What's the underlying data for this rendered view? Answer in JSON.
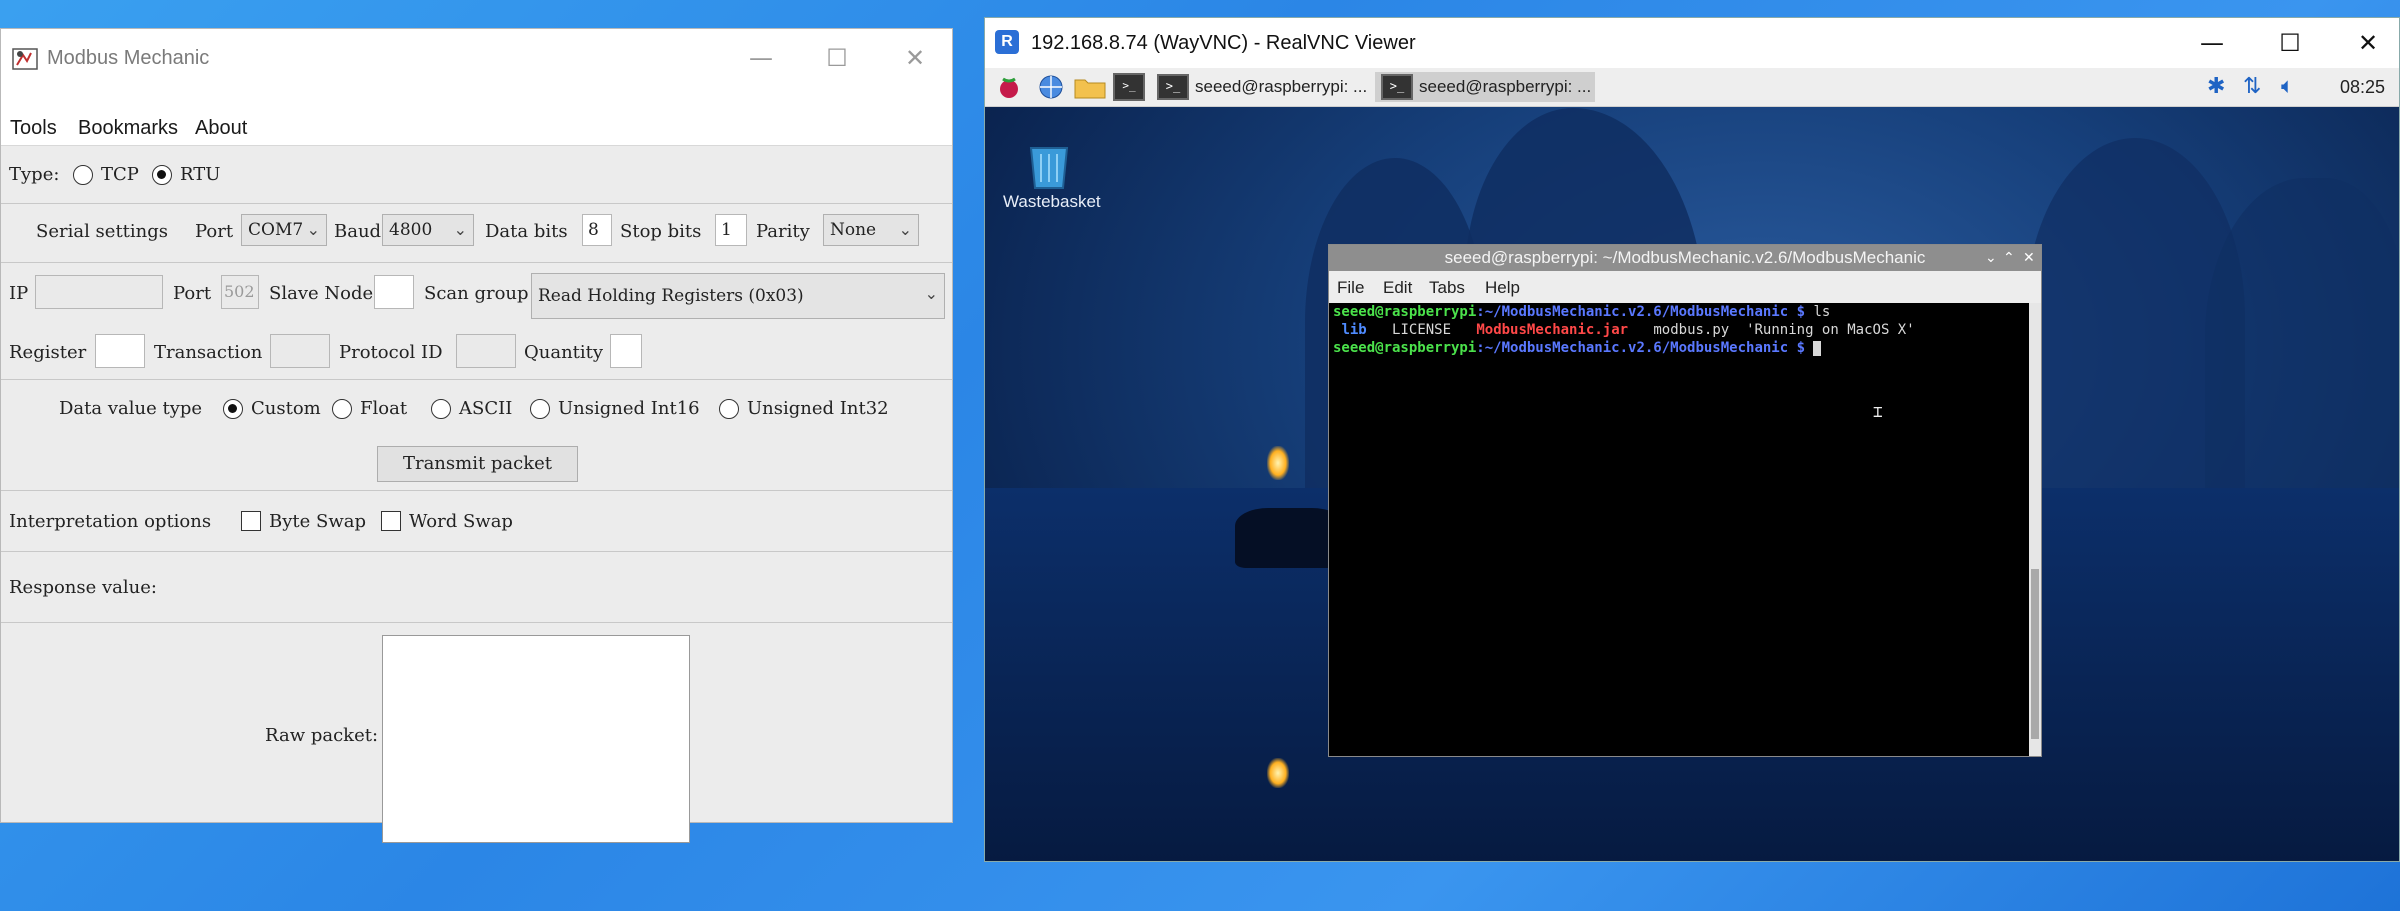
{
  "modbus_window": {
    "title": "Modbus Mechanic",
    "menu": [
      "Tools",
      "Bookmarks",
      "About"
    ],
    "type": {
      "label": "Type:",
      "options": [
        "TCP",
        "RTU"
      ],
      "selected": "RTU"
    },
    "serial": {
      "label": "Serial settings",
      "port_label": "Port",
      "port_value": "COM7",
      "baud_label": "Baud",
      "baud_value": "4800",
      "data_bits_label": "Data bits",
      "data_bits_value": "8",
      "stop_bits_label": "Stop bits",
      "stop_bits_value": "1",
      "parity_label": "Parity",
      "parity_value": "None"
    },
    "network": {
      "ip_label": "IP",
      "ip_value": "",
      "port_label": "Port",
      "port_value": "502",
      "slave_label": "Slave Node",
      "slave_value": "",
      "scan_label": "Scan group",
      "scan_value": "Read Holding Registers (0x03)"
    },
    "params": {
      "register_label": "Register",
      "register_value": "",
      "transaction_label": "Transaction",
      "transaction_value": "",
      "protocol_label": "Protocol ID",
      "protocol_value": "",
      "quantity_label": "Quantity",
      "quantity_value": ""
    },
    "data_value_type": {
      "label": "Data value type",
      "options": [
        "Custom",
        "Float",
        "ASCII",
        "Unsigned Int16",
        "Unsigned Int32"
      ],
      "selected": "Custom"
    },
    "transmit_button": "Transmit packet",
    "interpretation": {
      "label": "Interpretation options",
      "byte_swap": "Byte Swap",
      "word_swap": "Word Swap"
    },
    "response_label": "Response value:",
    "raw_packet_label": "Raw packet:"
  },
  "vnc_window": {
    "title": "192.168.8.74 (WayVNC) - RealVNC Viewer",
    "taskbar": {
      "tasks": [
        "seeed@raspberrypi: ...",
        "seeed@raspberrypi: ..."
      ],
      "clock": "08:25"
    },
    "desktop_icon": "Wastebasket",
    "terminal": {
      "title": "seeed@raspberrypi: ~/ModbusMechanic.v2.6/ModbusMechanic",
      "menu": [
        "File",
        "Edit",
        "Tabs",
        "Help"
      ],
      "prompt_user": "seeed@raspberrypi",
      "prompt_path": ":~/ModbusMechanic.v2.6/ModbusMechanic $",
      "command": " ls",
      "ls_items": [
        {
          "name": "lib",
          "kind": "dir"
        },
        {
          "name": "LICENSE",
          "kind": "file"
        },
        {
          "name": "ModbusMechanic.jar",
          "kind": "archive"
        },
        {
          "name": "modbus.py",
          "kind": "file"
        },
        {
          "name": "'Running on MacOS X'",
          "kind": "file"
        }
      ]
    }
  },
  "colors": {
    "accent_blue": "#2b86e6",
    "terminal_green": "#4be24b",
    "terminal_red": "#ff4848"
  }
}
